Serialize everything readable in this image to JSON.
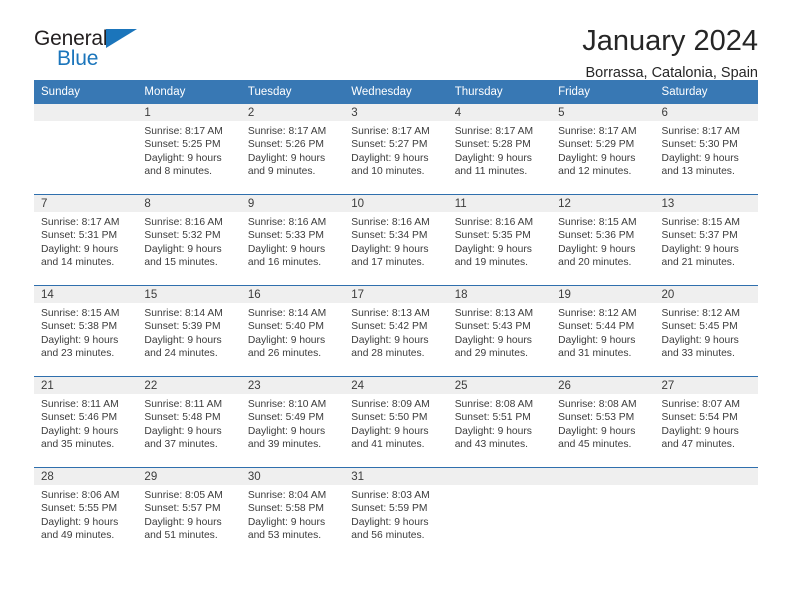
{
  "brand": {
    "name_top": "General",
    "name_bottom": "Blue",
    "logo_icon": "triangle-logo-icon"
  },
  "header": {
    "title": "January 2024",
    "subtitle": "Borrassa, Catalonia, Spain"
  },
  "calendar": {
    "weekday_headers": [
      "Sunday",
      "Monday",
      "Tuesday",
      "Wednesday",
      "Thursday",
      "Friday",
      "Saturday"
    ],
    "accent_color": "#3878b4",
    "rule_color": "#2f6fad",
    "daynum_band_color": "#efefef",
    "weeks": [
      [
        {
          "day": "",
          "lines": []
        },
        {
          "day": "1",
          "lines": [
            "Sunrise: 8:17 AM",
            "Sunset: 5:25 PM",
            "Daylight: 9 hours",
            "and 8 minutes."
          ]
        },
        {
          "day": "2",
          "lines": [
            "Sunrise: 8:17 AM",
            "Sunset: 5:26 PM",
            "Daylight: 9 hours",
            "and 9 minutes."
          ]
        },
        {
          "day": "3",
          "lines": [
            "Sunrise: 8:17 AM",
            "Sunset: 5:27 PM",
            "Daylight: 9 hours",
            "and 10 minutes."
          ]
        },
        {
          "day": "4",
          "lines": [
            "Sunrise: 8:17 AM",
            "Sunset: 5:28 PM",
            "Daylight: 9 hours",
            "and 11 minutes."
          ]
        },
        {
          "day": "5",
          "lines": [
            "Sunrise: 8:17 AM",
            "Sunset: 5:29 PM",
            "Daylight: 9 hours",
            "and 12 minutes."
          ]
        },
        {
          "day": "6",
          "lines": [
            "Sunrise: 8:17 AM",
            "Sunset: 5:30 PM",
            "Daylight: 9 hours",
            "and 13 minutes."
          ]
        }
      ],
      [
        {
          "day": "7",
          "lines": [
            "Sunrise: 8:17 AM",
            "Sunset: 5:31 PM",
            "Daylight: 9 hours",
            "and 14 minutes."
          ]
        },
        {
          "day": "8",
          "lines": [
            "Sunrise: 8:16 AM",
            "Sunset: 5:32 PM",
            "Daylight: 9 hours",
            "and 15 minutes."
          ]
        },
        {
          "day": "9",
          "lines": [
            "Sunrise: 8:16 AM",
            "Sunset: 5:33 PM",
            "Daylight: 9 hours",
            "and 16 minutes."
          ]
        },
        {
          "day": "10",
          "lines": [
            "Sunrise: 8:16 AM",
            "Sunset: 5:34 PM",
            "Daylight: 9 hours",
            "and 17 minutes."
          ]
        },
        {
          "day": "11",
          "lines": [
            "Sunrise: 8:16 AM",
            "Sunset: 5:35 PM",
            "Daylight: 9 hours",
            "and 19 minutes."
          ]
        },
        {
          "day": "12",
          "lines": [
            "Sunrise: 8:15 AM",
            "Sunset: 5:36 PM",
            "Daylight: 9 hours",
            "and 20 minutes."
          ]
        },
        {
          "day": "13",
          "lines": [
            "Sunrise: 8:15 AM",
            "Sunset: 5:37 PM",
            "Daylight: 9 hours",
            "and 21 minutes."
          ]
        }
      ],
      [
        {
          "day": "14",
          "lines": [
            "Sunrise: 8:15 AM",
            "Sunset: 5:38 PM",
            "Daylight: 9 hours",
            "and 23 minutes."
          ]
        },
        {
          "day": "15",
          "lines": [
            "Sunrise: 8:14 AM",
            "Sunset: 5:39 PM",
            "Daylight: 9 hours",
            "and 24 minutes."
          ]
        },
        {
          "day": "16",
          "lines": [
            "Sunrise: 8:14 AM",
            "Sunset: 5:40 PM",
            "Daylight: 9 hours",
            "and 26 minutes."
          ]
        },
        {
          "day": "17",
          "lines": [
            "Sunrise: 8:13 AM",
            "Sunset: 5:42 PM",
            "Daylight: 9 hours",
            "and 28 minutes."
          ]
        },
        {
          "day": "18",
          "lines": [
            "Sunrise: 8:13 AM",
            "Sunset: 5:43 PM",
            "Daylight: 9 hours",
            "and 29 minutes."
          ]
        },
        {
          "day": "19",
          "lines": [
            "Sunrise: 8:12 AM",
            "Sunset: 5:44 PM",
            "Daylight: 9 hours",
            "and 31 minutes."
          ]
        },
        {
          "day": "20",
          "lines": [
            "Sunrise: 8:12 AM",
            "Sunset: 5:45 PM",
            "Daylight: 9 hours",
            "and 33 minutes."
          ]
        }
      ],
      [
        {
          "day": "21",
          "lines": [
            "Sunrise: 8:11 AM",
            "Sunset: 5:46 PM",
            "Daylight: 9 hours",
            "and 35 minutes."
          ]
        },
        {
          "day": "22",
          "lines": [
            "Sunrise: 8:11 AM",
            "Sunset: 5:48 PM",
            "Daylight: 9 hours",
            "and 37 minutes."
          ]
        },
        {
          "day": "23",
          "lines": [
            "Sunrise: 8:10 AM",
            "Sunset: 5:49 PM",
            "Daylight: 9 hours",
            "and 39 minutes."
          ]
        },
        {
          "day": "24",
          "lines": [
            "Sunrise: 8:09 AM",
            "Sunset: 5:50 PM",
            "Daylight: 9 hours",
            "and 41 minutes."
          ]
        },
        {
          "day": "25",
          "lines": [
            "Sunrise: 8:08 AM",
            "Sunset: 5:51 PM",
            "Daylight: 9 hours",
            "and 43 minutes."
          ]
        },
        {
          "day": "26",
          "lines": [
            "Sunrise: 8:08 AM",
            "Sunset: 5:53 PM",
            "Daylight: 9 hours",
            "and 45 minutes."
          ]
        },
        {
          "day": "27",
          "lines": [
            "Sunrise: 8:07 AM",
            "Sunset: 5:54 PM",
            "Daylight: 9 hours",
            "and 47 minutes."
          ]
        }
      ],
      [
        {
          "day": "28",
          "lines": [
            "Sunrise: 8:06 AM",
            "Sunset: 5:55 PM",
            "Daylight: 9 hours",
            "and 49 minutes."
          ]
        },
        {
          "day": "29",
          "lines": [
            "Sunrise: 8:05 AM",
            "Sunset: 5:57 PM",
            "Daylight: 9 hours",
            "and 51 minutes."
          ]
        },
        {
          "day": "30",
          "lines": [
            "Sunrise: 8:04 AM",
            "Sunset: 5:58 PM",
            "Daylight: 9 hours",
            "and 53 minutes."
          ]
        },
        {
          "day": "31",
          "lines": [
            "Sunrise: 8:03 AM",
            "Sunset: 5:59 PM",
            "Daylight: 9 hours",
            "and 56 minutes."
          ]
        },
        {
          "day": "",
          "lines": []
        },
        {
          "day": "",
          "lines": []
        },
        {
          "day": "",
          "lines": []
        }
      ]
    ]
  }
}
